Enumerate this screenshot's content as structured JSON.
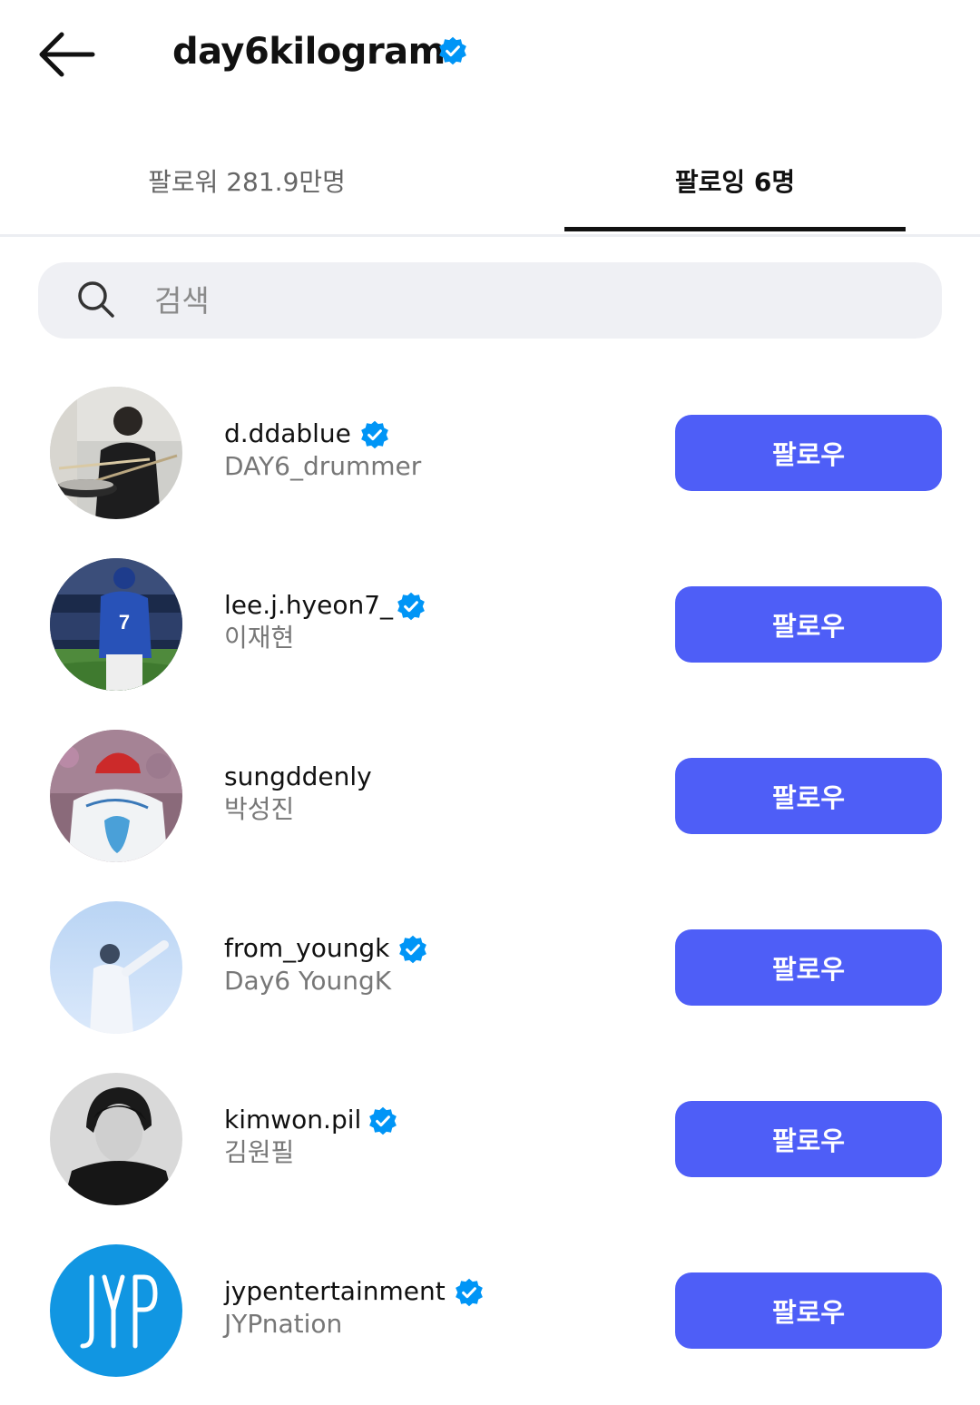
{
  "header": {
    "title": "day6kilogram"
  },
  "tabs": {
    "followers": "팔로워 281.9만명",
    "following": "팔로잉 6명"
  },
  "search": {
    "placeholder": "검색"
  },
  "users": [
    {
      "username": "d.ddablue",
      "subname": "DAY6_drummer",
      "button": "팔로우",
      "verified": true
    },
    {
      "username": "lee.j.hyeon7_",
      "subname": "이재현",
      "button": "팔로우",
      "verified": true
    },
    {
      "username": "sungddenly",
      "subname": "박성진",
      "button": "팔로우",
      "verified": false
    },
    {
      "username": "from_youngk",
      "subname": "Day6 YoungK",
      "button": "팔로우",
      "verified": true
    },
    {
      "username": "kimwon.pil",
      "subname": "김원필",
      "button": "팔로우",
      "verified": true
    },
    {
      "username": "jypentertainment",
      "subname": "JYPnation",
      "button": "팔로우",
      "verified": true
    }
  ],
  "colors": {
    "accent": "#4e5ef7",
    "verified": "#0095f6",
    "jyp_blue": "#1196e2"
  },
  "icons": {
    "back": "arrow-left-icon",
    "search": "search-icon",
    "verified": "verified-badge-icon"
  }
}
